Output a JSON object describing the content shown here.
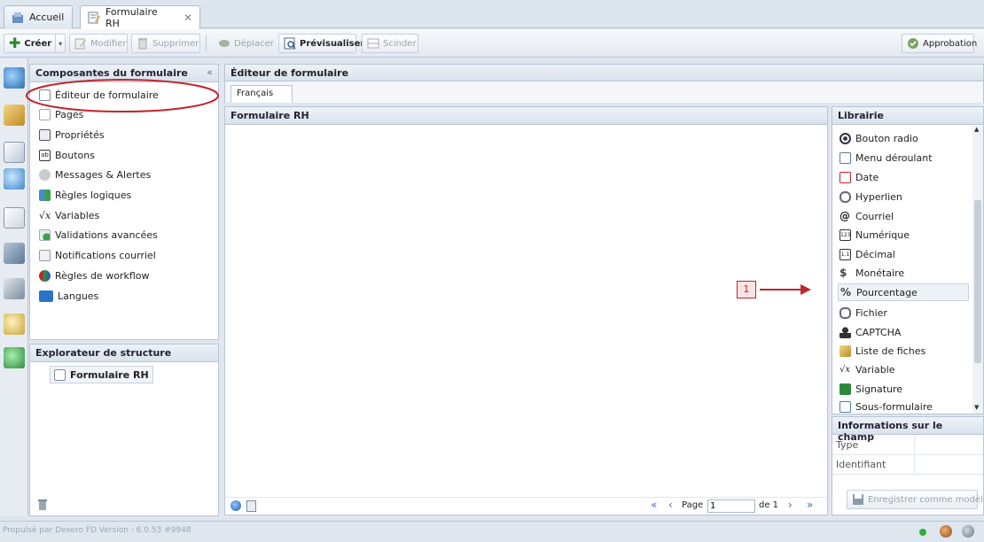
{
  "tabs": [
    {
      "label": "Accueil",
      "icon": "home-icon"
    },
    {
      "label": "Formulaire RH",
      "icon": "form-icon",
      "close": "✕"
    }
  ],
  "toolbar": {
    "create": "Créer",
    "modify": "Modifier",
    "delete": "Supprimer",
    "move": "Déplacer",
    "preview": "Prévisualiser",
    "split": "Scinder",
    "approval": "Approbation"
  },
  "components_panel": {
    "title": "Composantes du formulaire",
    "collapse": "«",
    "items": [
      {
        "label": "Éditeur de formulaire",
        "icon": "form-editor-icon"
      },
      {
        "label": "Pages",
        "icon": "pages-icon"
      },
      {
        "label": "Propriétés",
        "icon": "properties-icon"
      },
      {
        "label": "Boutons",
        "icon": "buttons-icon"
      },
      {
        "label": "Messages & Alertes",
        "icon": "messages-icon"
      },
      {
        "label": "Règles logiques",
        "icon": "logic-rules-icon"
      },
      {
        "label": "Variables",
        "icon": "variables-icon"
      },
      {
        "label": "Validations avancées",
        "icon": "validations-icon"
      },
      {
        "label": "Notifications courriel",
        "icon": "email-notification-icon"
      },
      {
        "label": "Règles de workflow",
        "icon": "workflow-icon"
      },
      {
        "label": "Langues",
        "icon": "languages-icon"
      }
    ]
  },
  "structure_panel": {
    "title": "Explorateur de structure",
    "root": "Formulaire RH"
  },
  "editor": {
    "title": "Éditeur de formulaire",
    "language_tab": "Français",
    "form_title": "Formulaire RH",
    "pager": {
      "page_label": "Page",
      "page_value": "1",
      "of_label": "de 1"
    }
  },
  "library": {
    "title": "Librairie",
    "items": [
      {
        "label": "Bouton radio",
        "icon": "radio-icon"
      },
      {
        "label": "Menu déroulant",
        "icon": "dropdown-icon"
      },
      {
        "label": "Date",
        "icon": "date-icon"
      },
      {
        "label": "Hyperlien",
        "icon": "hyperlink-icon"
      },
      {
        "label": "Courriel",
        "icon": "at-icon"
      },
      {
        "label": "Numérique",
        "icon": "numeric-icon"
      },
      {
        "label": "Décimal",
        "icon": "decimal-icon"
      },
      {
        "label": "Monétaire",
        "icon": "currency-icon"
      },
      {
        "label": "Pourcentage",
        "icon": "percent-icon"
      },
      {
        "label": "Fichier",
        "icon": "file-icon"
      },
      {
        "label": "CAPTCHA",
        "icon": "captcha-icon"
      },
      {
        "label": "Liste de fiches",
        "icon": "records-list-icon"
      },
      {
        "label": "Variable",
        "icon": "variable-icon"
      },
      {
        "label": "Signature",
        "icon": "signature-icon"
      },
      {
        "label": "Sous-formulaire",
        "icon": "subform-icon"
      }
    ]
  },
  "field_info": {
    "title": "Informations sur le champ",
    "rows": [
      {
        "label": "Type",
        "value": ""
      },
      {
        "label": "Identifiant",
        "value": ""
      }
    ],
    "save_template": "Enregistrer comme modèle"
  },
  "annotation": {
    "number": "1"
  },
  "status": {
    "text": "Propulsé par Dexero FD Version : 6.0.53 #9948"
  },
  "colors": {
    "accent_red": "#c0262d",
    "header_bg": "#d9e2ec",
    "border": "#b7c5d5"
  }
}
